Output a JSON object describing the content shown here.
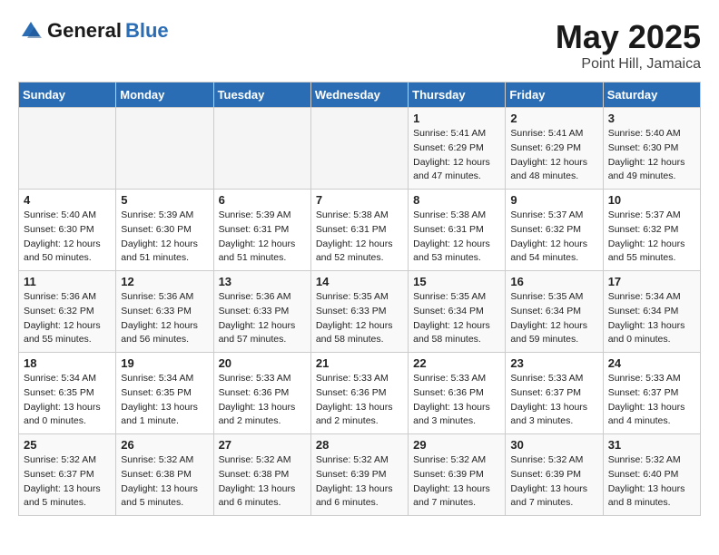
{
  "header": {
    "logo_general": "General",
    "logo_blue": "Blue",
    "month": "May 2025",
    "location": "Point Hill, Jamaica"
  },
  "weekdays": [
    "Sunday",
    "Monday",
    "Tuesday",
    "Wednesday",
    "Thursday",
    "Friday",
    "Saturday"
  ],
  "weeks": [
    [
      {
        "day": "",
        "empty": true
      },
      {
        "day": "",
        "empty": true
      },
      {
        "day": "",
        "empty": true
      },
      {
        "day": "",
        "empty": true
      },
      {
        "day": "1",
        "line1": "Sunrise: 5:41 AM",
        "line2": "Sunset: 6:29 PM",
        "line3": "Daylight: 12 hours",
        "line4": "and 47 minutes."
      },
      {
        "day": "2",
        "line1": "Sunrise: 5:41 AM",
        "line2": "Sunset: 6:29 PM",
        "line3": "Daylight: 12 hours",
        "line4": "and 48 minutes."
      },
      {
        "day": "3",
        "line1": "Sunrise: 5:40 AM",
        "line2": "Sunset: 6:30 PM",
        "line3": "Daylight: 12 hours",
        "line4": "and 49 minutes."
      }
    ],
    [
      {
        "day": "4",
        "line1": "Sunrise: 5:40 AM",
        "line2": "Sunset: 6:30 PM",
        "line3": "Daylight: 12 hours",
        "line4": "and 50 minutes."
      },
      {
        "day": "5",
        "line1": "Sunrise: 5:39 AM",
        "line2": "Sunset: 6:30 PM",
        "line3": "Daylight: 12 hours",
        "line4": "and 51 minutes."
      },
      {
        "day": "6",
        "line1": "Sunrise: 5:39 AM",
        "line2": "Sunset: 6:31 PM",
        "line3": "Daylight: 12 hours",
        "line4": "and 51 minutes."
      },
      {
        "day": "7",
        "line1": "Sunrise: 5:38 AM",
        "line2": "Sunset: 6:31 PM",
        "line3": "Daylight: 12 hours",
        "line4": "and 52 minutes."
      },
      {
        "day": "8",
        "line1": "Sunrise: 5:38 AM",
        "line2": "Sunset: 6:31 PM",
        "line3": "Daylight: 12 hours",
        "line4": "and 53 minutes."
      },
      {
        "day": "9",
        "line1": "Sunrise: 5:37 AM",
        "line2": "Sunset: 6:32 PM",
        "line3": "Daylight: 12 hours",
        "line4": "and 54 minutes."
      },
      {
        "day": "10",
        "line1": "Sunrise: 5:37 AM",
        "line2": "Sunset: 6:32 PM",
        "line3": "Daylight: 12 hours",
        "line4": "and 55 minutes."
      }
    ],
    [
      {
        "day": "11",
        "line1": "Sunrise: 5:36 AM",
        "line2": "Sunset: 6:32 PM",
        "line3": "Daylight: 12 hours",
        "line4": "and 55 minutes."
      },
      {
        "day": "12",
        "line1": "Sunrise: 5:36 AM",
        "line2": "Sunset: 6:33 PM",
        "line3": "Daylight: 12 hours",
        "line4": "and 56 minutes."
      },
      {
        "day": "13",
        "line1": "Sunrise: 5:36 AM",
        "line2": "Sunset: 6:33 PM",
        "line3": "Daylight: 12 hours",
        "line4": "and 57 minutes."
      },
      {
        "day": "14",
        "line1": "Sunrise: 5:35 AM",
        "line2": "Sunset: 6:33 PM",
        "line3": "Daylight: 12 hours",
        "line4": "and 58 minutes."
      },
      {
        "day": "15",
        "line1": "Sunrise: 5:35 AM",
        "line2": "Sunset: 6:34 PM",
        "line3": "Daylight: 12 hours",
        "line4": "and 58 minutes."
      },
      {
        "day": "16",
        "line1": "Sunrise: 5:35 AM",
        "line2": "Sunset: 6:34 PM",
        "line3": "Daylight: 12 hours",
        "line4": "and 59 minutes."
      },
      {
        "day": "17",
        "line1": "Sunrise: 5:34 AM",
        "line2": "Sunset: 6:34 PM",
        "line3": "Daylight: 13 hours",
        "line4": "and 0 minutes."
      }
    ],
    [
      {
        "day": "18",
        "line1": "Sunrise: 5:34 AM",
        "line2": "Sunset: 6:35 PM",
        "line3": "Daylight: 13 hours",
        "line4": "and 0 minutes."
      },
      {
        "day": "19",
        "line1": "Sunrise: 5:34 AM",
        "line2": "Sunset: 6:35 PM",
        "line3": "Daylight: 13 hours",
        "line4": "and 1 minute."
      },
      {
        "day": "20",
        "line1": "Sunrise: 5:33 AM",
        "line2": "Sunset: 6:36 PM",
        "line3": "Daylight: 13 hours",
        "line4": "and 2 minutes."
      },
      {
        "day": "21",
        "line1": "Sunrise: 5:33 AM",
        "line2": "Sunset: 6:36 PM",
        "line3": "Daylight: 13 hours",
        "line4": "and 2 minutes."
      },
      {
        "day": "22",
        "line1": "Sunrise: 5:33 AM",
        "line2": "Sunset: 6:36 PM",
        "line3": "Daylight: 13 hours",
        "line4": "and 3 minutes."
      },
      {
        "day": "23",
        "line1": "Sunrise: 5:33 AM",
        "line2": "Sunset: 6:37 PM",
        "line3": "Daylight: 13 hours",
        "line4": "and 3 minutes."
      },
      {
        "day": "24",
        "line1": "Sunrise: 5:33 AM",
        "line2": "Sunset: 6:37 PM",
        "line3": "Daylight: 13 hours",
        "line4": "and 4 minutes."
      }
    ],
    [
      {
        "day": "25",
        "line1": "Sunrise: 5:32 AM",
        "line2": "Sunset: 6:37 PM",
        "line3": "Daylight: 13 hours",
        "line4": "and 5 minutes."
      },
      {
        "day": "26",
        "line1": "Sunrise: 5:32 AM",
        "line2": "Sunset: 6:38 PM",
        "line3": "Daylight: 13 hours",
        "line4": "and 5 minutes."
      },
      {
        "day": "27",
        "line1": "Sunrise: 5:32 AM",
        "line2": "Sunset: 6:38 PM",
        "line3": "Daylight: 13 hours",
        "line4": "and 6 minutes."
      },
      {
        "day": "28",
        "line1": "Sunrise: 5:32 AM",
        "line2": "Sunset: 6:39 PM",
        "line3": "Daylight: 13 hours",
        "line4": "and 6 minutes."
      },
      {
        "day": "29",
        "line1": "Sunrise: 5:32 AM",
        "line2": "Sunset: 6:39 PM",
        "line3": "Daylight: 13 hours",
        "line4": "and 7 minutes."
      },
      {
        "day": "30",
        "line1": "Sunrise: 5:32 AM",
        "line2": "Sunset: 6:39 PM",
        "line3": "Daylight: 13 hours",
        "line4": "and 7 minutes."
      },
      {
        "day": "31",
        "line1": "Sunrise: 5:32 AM",
        "line2": "Sunset: 6:40 PM",
        "line3": "Daylight: 13 hours",
        "line4": "and 8 minutes."
      }
    ]
  ]
}
